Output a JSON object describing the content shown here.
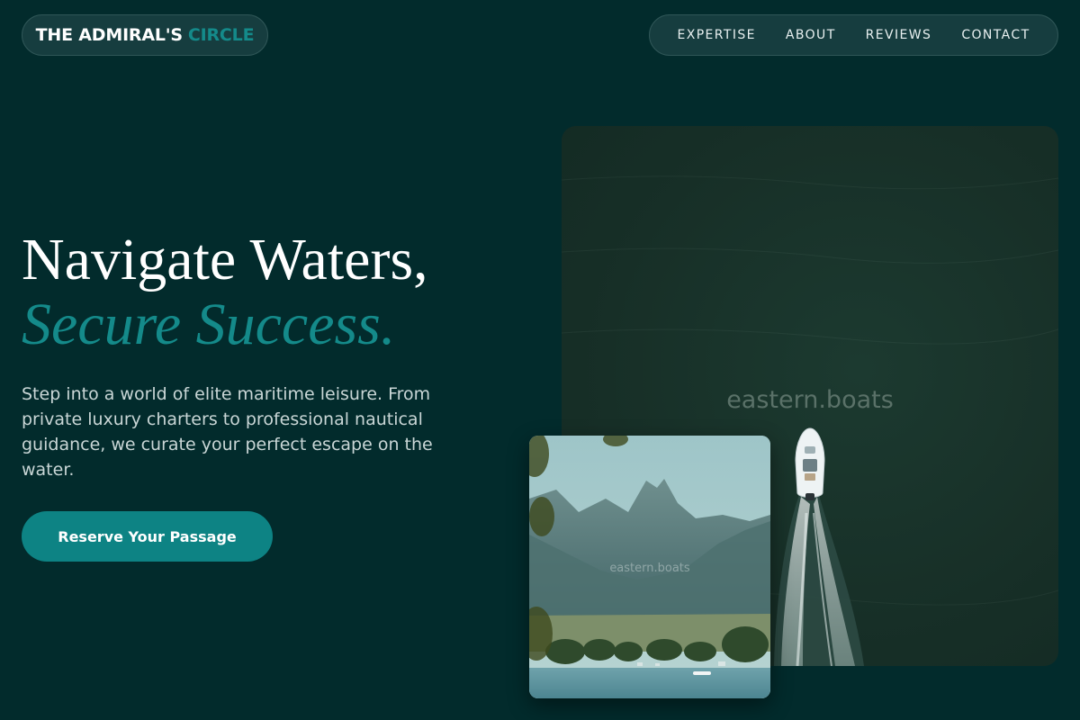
{
  "brand": {
    "name_part1": "THE ADMIRAL'S",
    "name_part2": "CIRCLE",
    "accent_color": "#148a8a"
  },
  "nav": {
    "items": [
      "EXPERTISE",
      "ABOUT",
      "REVIEWS",
      "CONTACT"
    ]
  },
  "hero": {
    "title_line1": "Navigate Waters,",
    "title_line2": "Secure Success.",
    "description": "Step into a world of elite maritime leisure. From private luxury charters to professional nautical guidance, we curate your perfect escape on the water.",
    "cta_label": "Reserve Your Passage"
  },
  "images": {
    "large": {
      "watermark": "eastern.boats",
      "subject": "aerial view of speedboat on dark green water"
    },
    "small": {
      "watermark": "eastern.boats",
      "subject": "mountain lake landscape"
    }
  },
  "colors": {
    "background": "#022b2c",
    "pill_background": "#163d3f",
    "button": "#0d8384"
  }
}
